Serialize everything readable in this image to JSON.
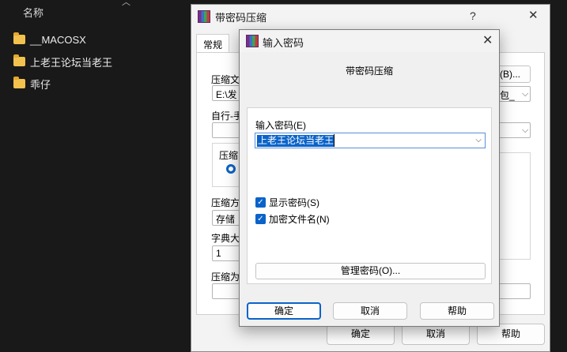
{
  "explorer": {
    "header": "名称",
    "items": [
      {
        "name": "__MACOSX",
        "icon": "folder-icon"
      },
      {
        "name": "上老王论坛当老王",
        "icon": "folder-icon"
      },
      {
        "name": "乖仔",
        "icon": "folder-icon"
      }
    ]
  },
  "archive_dialog": {
    "title": "带密码压缩",
    "help_glyph": "?",
    "close_glyph": "✕",
    "tab_general": "常规",
    "archive_name_label": "压缩文",
    "archive_path_value": "E:\\发",
    "browse_button": "(B)...",
    "profiles_value": "包_",
    "update_mode_label": "自行-手",
    "archive_format_label": "压缩",
    "compression_method_label": "压缩方",
    "compression_method_value": "存储",
    "dictionary_label": "字典大",
    "dictionary_value": "1",
    "split_label": "压缩为",
    "buttons": {
      "ok": "确定",
      "cancel": "取消",
      "help": "帮助"
    }
  },
  "password_dialog": {
    "title": "输入密码",
    "close_glyph": "✕",
    "subtitle": "带密码压缩",
    "password_label": "输入密码(E)",
    "password_value": "上老王论坛当老王",
    "show_password": {
      "label": "显示密码(S)",
      "checked": true
    },
    "encrypt_filenames": {
      "label": "加密文件名(N)",
      "checked": true
    },
    "manage_button": "管理密码(O)...",
    "buttons": {
      "ok": "确定",
      "cancel": "取消",
      "help": "帮助"
    }
  },
  "colors": {
    "accent": "#0a63c9",
    "explorer_bg": "#191919",
    "folder": "#f2c14e"
  }
}
